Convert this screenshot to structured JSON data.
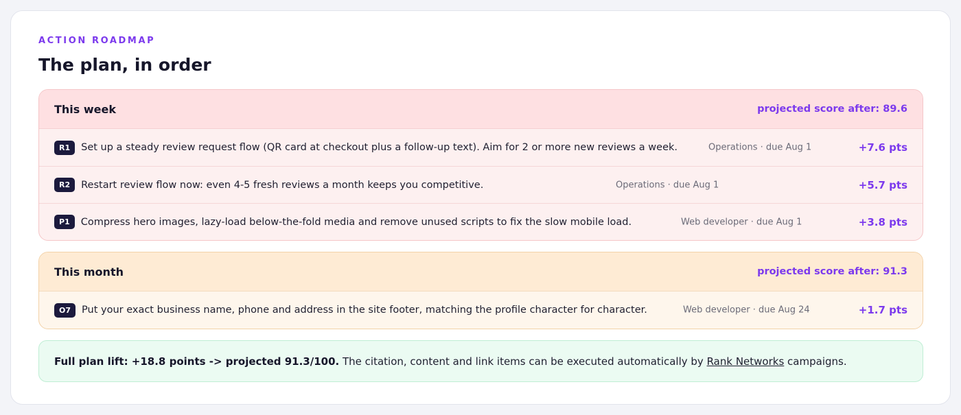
{
  "header": {
    "eyebrow": "ACTION ROADMAP",
    "title": "The plan, in order"
  },
  "sections": [
    {
      "name": "This week",
      "projected": "projected score after: 89.6",
      "items": [
        {
          "tag": "R1",
          "text": "Set up a steady review request flow (QR card at checkout plus a follow-up text). Aim for 2 or more new reviews a week.",
          "meta": "Operations · due Aug 1",
          "points": "+7.6 pts"
        },
        {
          "tag": "R2",
          "text": "Restart review flow now: even 4-5 fresh reviews a month keeps you competitive.",
          "meta": "Operations · due Aug 1",
          "points": "+5.7 pts"
        },
        {
          "tag": "P1",
          "text": "Compress hero images, lazy-load below-the-fold media and remove unused scripts to fix the slow mobile load.",
          "meta": "Web developer · due Aug 1",
          "points": "+3.8 pts"
        }
      ]
    },
    {
      "name": "This month",
      "projected": "projected score after: 91.3",
      "items": [
        {
          "tag": "O7",
          "text": "Put your exact business name, phone and address in the site footer, matching the profile character for character.",
          "meta": "Web developer · due Aug 24",
          "points": "+1.7 pts"
        }
      ]
    }
  ],
  "summary": {
    "bold": "Full plan lift: +18.8 points -> projected 91.3/100.",
    "text_before_link": " The citation, content and link items can be executed automatically by ",
    "link": "Rank Networks",
    "text_after_link": " campaigns."
  },
  "colors": {
    "accent": "#7c3aed",
    "week_bg": "#fee0e2",
    "month_bg": "#feebd4",
    "summary_bg": "#ebfbf2",
    "tag_bg": "#1c1a3d"
  }
}
